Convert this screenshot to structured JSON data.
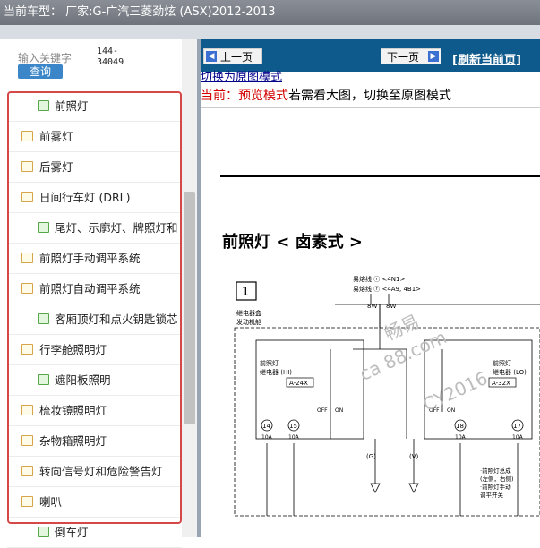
{
  "window": {
    "title": "当前车型： 厂家:G-广汽三菱劲炫 (ASX)2012-2013"
  },
  "search": {
    "keyword_label": "输入关键字",
    "button_label": "查询",
    "code_line1": "144-",
    "code_line2": "34049"
  },
  "tree": {
    "items": [
      {
        "label": "前照灯",
        "type": "folder",
        "level": 2
      },
      {
        "label": "前雾灯",
        "type": "doc",
        "level": 1
      },
      {
        "label": "后雾灯",
        "type": "doc",
        "level": 1
      },
      {
        "label": "日间行车灯 (DRL)",
        "type": "doc",
        "level": 1
      },
      {
        "label": "尾灯、示廓灯、牌照灯和",
        "type": "folder",
        "level": 2
      },
      {
        "label": "前照灯手动调平系统",
        "type": "doc",
        "level": 1
      },
      {
        "label": "前照灯自动调平系统",
        "type": "doc",
        "level": 1
      },
      {
        "label": "客厢顶灯和点火钥匙锁芯",
        "type": "folder",
        "level": 2
      },
      {
        "label": "行李舱照明灯",
        "type": "doc",
        "level": 1
      },
      {
        "label": "遮阳板照明",
        "type": "folder",
        "level": 2
      },
      {
        "label": "梳妆镜照明灯",
        "type": "doc",
        "level": 1
      },
      {
        "label": "杂物箱照明灯",
        "type": "doc",
        "level": 1
      },
      {
        "label": "转向信号灯和危险警告灯",
        "type": "doc",
        "level": 1
      },
      {
        "label": "喇叭",
        "type": "doc",
        "level": 1
      },
      {
        "label": "倒车灯",
        "type": "folder",
        "level": 2
      }
    ]
  },
  "nav": {
    "prev_label": "上一页",
    "next_label": "下一页",
    "refresh_label": "[刷新当前页]"
  },
  "content": {
    "switch_link": "切换为原图模式",
    "current_prefix": "当前：预览模式",
    "current_suffix": "若需看大图，切换至原图模式",
    "heading": "前照灯 < 卤素式 >"
  },
  "diagram": {
    "number": "1",
    "fuse_line1": "易熔线 ⓡ <4N1>",
    "fuse_line2": "易熔线 ⓡ <4A9, 4B1>",
    "wire_8w": "8W",
    "relay_box_label": "继电器盒",
    "engine_bay_label": "发动机舱",
    "relay_hi_label": "前照灯\n继电器 (HI)",
    "relay_hi_code": "A-24X",
    "relay_lo_label": "前照灯\n继电器 (LO)",
    "relay_lo_code": "A-32X",
    "fuse_left_num": "14",
    "fuse_left_amp": "10A",
    "fuse_mid_num": "15",
    "fuse_mid_amp": "10A",
    "fuse_r1_num": "18",
    "fuse_r1_amp": "10A",
    "fuse_r2_num": "17",
    "fuse_r2_amp": "10A",
    "wire_g": "(G)",
    "wire_v": "(V)",
    "note_line1": "·前照灯总成",
    "note_line2": "(左侧，右侧)",
    "note_line3": "·前照灯手动",
    "note_line4": "调平开关",
    "pin_off": "OFF",
    "pin_on": "ON"
  },
  "watermark": {
    "text1": "畅易",
    "text2": "ca 88.com",
    "text3": "CY2016"
  },
  "colors": {
    "nav_bg": "#0e5a8c",
    "highlight": "#d64848",
    "red_text": "#d40000"
  }
}
